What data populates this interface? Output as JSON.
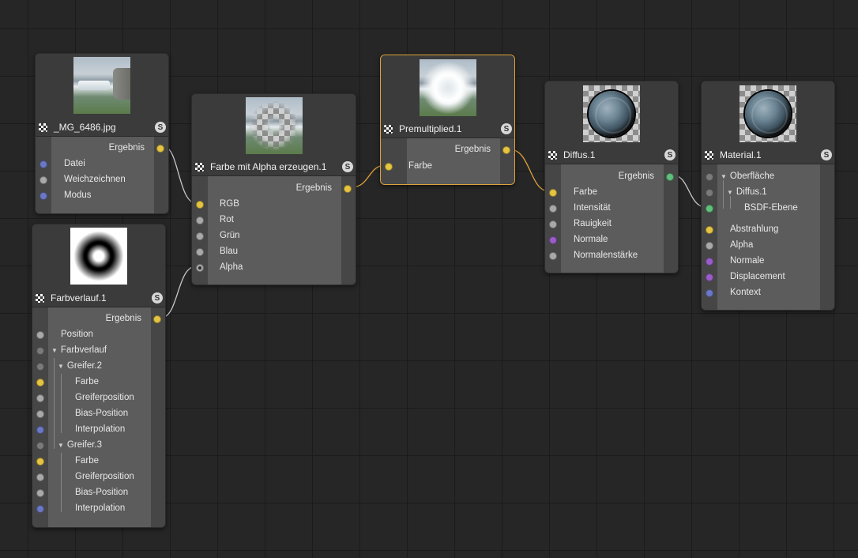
{
  "nodes": {
    "image": {
      "title": "_MG_6486.jpg",
      "badge": "S",
      "output": "Ergebnis",
      "inputs": [
        "Datei",
        "Weichzeichnen",
        "Modus"
      ]
    },
    "gradient": {
      "title": "Farbverlauf.1",
      "badge": "S",
      "output": "Ergebnis",
      "inputs": {
        "position": "Position",
        "farbverlauf": "Farbverlauf",
        "greifer2": "Greifer.2",
        "g2_farbe": "Farbe",
        "g2_greiferposition": "Greiferposition",
        "g2_bias": "Bias-Position",
        "g2_interpolation": "Interpolation",
        "greifer3": "Greifer.3",
        "g3_farbe": "Farbe",
        "g3_greiferposition": "Greiferposition",
        "g3_bias": "Bias-Position",
        "g3_interpolation": "Interpolation"
      }
    },
    "alpha": {
      "title": "Farbe mit Alpha erzeugen.1",
      "badge": "S",
      "output": "Ergebnis",
      "inputs": [
        "RGB",
        "Rot",
        "Grün",
        "Blau",
        "Alpha"
      ]
    },
    "premult": {
      "title": "Premultiplied.1",
      "badge": "S",
      "output": "Ergebnis",
      "inputs": [
        "Farbe"
      ]
    },
    "diffuse": {
      "title": "Diffus.1",
      "badge": "S",
      "output": "Ergebnis",
      "inputs": [
        "Farbe",
        "Intensität",
        "Rauigkeit",
        "Normale",
        "Normalenstärke"
      ]
    },
    "material": {
      "title": "Material.1",
      "badge": "S",
      "inputs": {
        "oberflaeche": "Oberfläche",
        "diffus": "Diffus.1",
        "bsdf": "BSDF-Ebene",
        "abstrahlung": "Abstrahlung",
        "alpha": "Alpha",
        "normale": "Normale",
        "displacement": "Displacement",
        "kontext": "Kontext"
      }
    }
  },
  "colors": {
    "selected_border": "#e0a23a",
    "wire_default": "#c8c8c8",
    "wire_selected": "#e0a23a",
    "port_color": "#e4c440",
    "port_float": "#a9a9a9",
    "port_vector": "#6a77c4",
    "port_normal": "#9a5cc9",
    "port_bsdf": "#5ec07a"
  }
}
